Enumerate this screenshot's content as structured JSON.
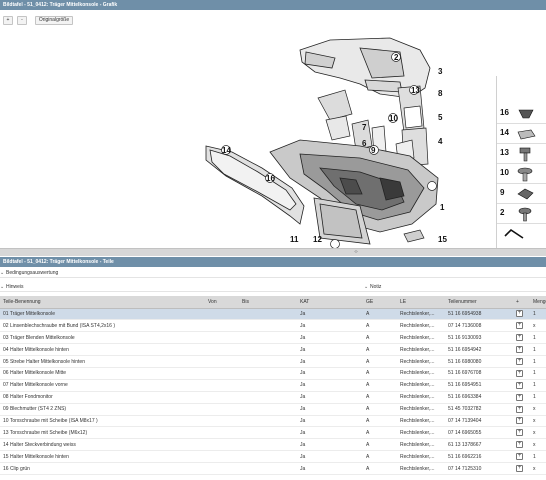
{
  "graphic_header": {
    "title": "Bildtafel - 51_0412: Träger Mittelkonsole - Grafik"
  },
  "toolbar": {
    "zoom_in": "+",
    "zoom_out": "-",
    "original_size": "Originalgröße"
  },
  "diagram": {
    "callouts": [
      "1",
      "2",
      "3",
      "4",
      "5",
      "6",
      "7",
      "8",
      "9",
      "10",
      "11",
      "12",
      "13",
      "14",
      "15",
      "16"
    ],
    "side_numbers": [
      "16",
      "14",
      "13",
      "10",
      "9",
      "2"
    ]
  },
  "parts_header": {
    "title": "Bildtafel - 51_0412: Träger Mittelkonsole - Teile"
  },
  "filters": {
    "conditions": "Bedingungsauswertung",
    "hint": "Hinweis",
    "note": "Notiz"
  },
  "table": {
    "columns": [
      "Teile-Benennung",
      "Von",
      "Bis",
      "KAT",
      "GE",
      "LE",
      "Teilenummer",
      "+",
      "Menge"
    ],
    "rows": [
      {
        "name": "01 Träger Mittelkonsole",
        "von": "",
        "bis": "",
        "kat": "Ja",
        "ge": "A",
        "le": "Rechtslenker,...",
        "nr": "51 16 6954938",
        "menge": "1"
      },
      {
        "name": "02 Linsenblechschraube mit Bund (ISA ST4,2x16 )",
        "von": "",
        "bis": "",
        "kat": "Ja",
        "ge": "A",
        "le": "Rechtslenker,...",
        "nr": "07 14 7136008",
        "menge": "x"
      },
      {
        "name": "03 Träger Blenden Mittelkonsole",
        "von": "",
        "bis": "",
        "kat": "Ja",
        "ge": "A",
        "le": "Rechtslenker,...",
        "nr": "51 16 9130093",
        "menge": "1"
      },
      {
        "name": "04 Halter Mittelkonsole hinten",
        "von": "",
        "bis": "",
        "kat": "Ja",
        "ge": "A",
        "le": "Rechtslenker,...",
        "nr": "51 16 6954942",
        "menge": "1"
      },
      {
        "name": "05 Strebe Halter Mittelkonsole hinten",
        "von": "",
        "bis": "",
        "kat": "Ja",
        "ge": "A",
        "le": "Rechtslenker,...",
        "nr": "51 16 6980080",
        "menge": "1"
      },
      {
        "name": "06 Halter Mittelkonsole Mitte",
        "von": "",
        "bis": "",
        "kat": "Ja",
        "ge": "A",
        "le": "Rechtslenker,...",
        "nr": "51 16 6976708",
        "menge": "1"
      },
      {
        "name": "07 Halter Mittelkonsole vorne",
        "von": "",
        "bis": "",
        "kat": "Ja",
        "ge": "A",
        "le": "Rechtslenker,...",
        "nr": "51 16 6954951",
        "menge": "1"
      },
      {
        "name": "08 Halter Fondmonitor",
        "von": "",
        "bis": "",
        "kat": "Ja",
        "ge": "A",
        "le": "Rechtslenker,...",
        "nr": "51 16 6963384",
        "menge": "1"
      },
      {
        "name": "09 Blechmutter (ST4 2 ZNS)",
        "von": "",
        "bis": "",
        "kat": "Ja",
        "ge": "A",
        "le": "Rechtslenker,...",
        "nr": "51 45 7032782",
        "menge": "x"
      },
      {
        "name": "10 Torxschraube mit Scheibe (ISA M8x17 )",
        "von": "",
        "bis": "",
        "kat": "Ja",
        "ge": "A",
        "le": "Rechtslenker,...",
        "nr": "07 14 7139404",
        "menge": "x"
      },
      {
        "name": "13 Torxschraube mit Scheibe (M6x12)",
        "von": "",
        "bis": "",
        "kat": "Ja",
        "ge": "A",
        "le": "Rechtslenker,...",
        "nr": "07 14 6965055",
        "menge": "x"
      },
      {
        "name": "14 Halter Steckverbindung weiss",
        "von": "",
        "bis": "",
        "kat": "Ja",
        "ge": "A",
        "le": "Rechtslenker,...",
        "nr": "61 13 1378667",
        "menge": "x"
      },
      {
        "name": "15 Halter Mittelkonsole hinten",
        "von": "",
        "bis": "",
        "kat": "Ja",
        "ge": "A",
        "le": "Rechtslenker,...",
        "nr": "51 16 6962216",
        "menge": "1"
      },
      {
        "name": "16 Clip grün",
        "von": "",
        "bis": "",
        "kat": "Ja",
        "ge": "A",
        "le": "Rechtslenker,...",
        "nr": "07 14 7125310",
        "menge": "x"
      }
    ]
  },
  "colors": {
    "header_bar": "#6f8fa8",
    "selected_row": "#cfdbe8",
    "table_header": "#d9d9d9"
  }
}
